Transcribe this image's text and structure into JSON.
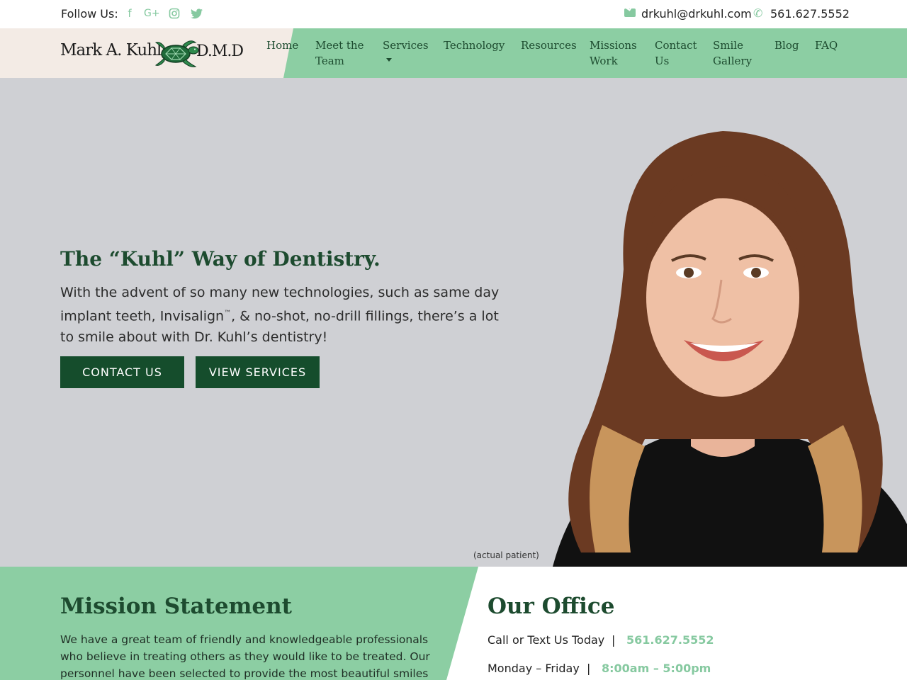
{
  "topbar": {
    "follow_label": "Follow Us:",
    "social_icons": [
      "facebook-icon",
      "google-plus-icon",
      "instagram-icon",
      "twitter-icon"
    ],
    "email": "drkuhl@drkuhl.com",
    "phone": "561.627.5552"
  },
  "logo": {
    "name_part": "Mark A. Kuhl,",
    "suffix_part": "D.M.D"
  },
  "nav": {
    "items": [
      {
        "label": "Home"
      },
      {
        "label": "Meet the\nTeam"
      },
      {
        "label": "Services"
      },
      {
        "label": "Technology"
      },
      {
        "label": "Resources"
      },
      {
        "label": "Missions\nWork"
      },
      {
        "label": "Contact\nUs"
      },
      {
        "label": "Smile\nGallery"
      },
      {
        "label": "Blog"
      },
      {
        "label": "FAQ"
      }
    ]
  },
  "hero": {
    "title": "The “Kuhl” Way of Dentistry.",
    "text_before_tm": "With the advent of so many new technologies, such as same day implant teeth, Invisalign",
    "tm": "™",
    "text_after_tm": ", & no-shot, no-drill fillings, there’s a lot to smile about with Dr. Kuhl’s dentistry!",
    "contact_button": "CONTACT US",
    "services_button": "VIEW SERVICES",
    "photo_caption": "(actual patient)"
  },
  "mission": {
    "title": "Mission Statement",
    "text": "We have a great team of friendly and knowledgeable professionals who believe in treating others as they would like to be treated. Our personnel have been selected to provide the most beautiful smiles"
  },
  "office": {
    "title": "Our Office",
    "call_label": "Call or Text Us Today",
    "call_value": "561.627.5552",
    "hours_label": "Monday – Friday",
    "hours_value": "8:00am – 5:00pm",
    "separator": "|"
  },
  "colors": {
    "accent_green": "#8ccea3",
    "dark_green": "#154d2c",
    "heading_green": "#1d4b2f",
    "hero_bg": "#cfd0d4"
  }
}
